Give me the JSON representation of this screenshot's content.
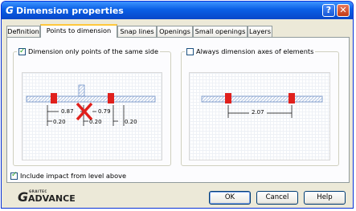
{
  "window": {
    "title": "Dimension properties",
    "help_label": "?",
    "close_label": "✕",
    "logo_glyph": "G"
  },
  "tabs": [
    {
      "label": "Definition",
      "active": false
    },
    {
      "label": "Points to dimension",
      "active": true
    },
    {
      "label": "Snap lines",
      "active": false
    },
    {
      "label": "Openings",
      "active": false
    },
    {
      "label": "Small openings",
      "active": false
    },
    {
      "label": "Layers",
      "active": false
    }
  ],
  "left_group": {
    "checkbox_label": "Dimension only points of the same side",
    "checked": true,
    "dims": {
      "d1": "0.87",
      "d2": "0.79",
      "s1": "0.20",
      "s2": "0.20",
      "s3": "0.20"
    }
  },
  "right_group": {
    "checkbox_label": "Always dimension axes of elements",
    "checked": false,
    "dims": {
      "d1": "2.07"
    }
  },
  "impact": {
    "label": "Include impact from level above",
    "checked": true
  },
  "logo": {
    "mark": "G",
    "small": "GRAITEC",
    "text": "ADVANCE"
  },
  "buttons": {
    "ok": "OK",
    "cancel": "Cancel",
    "help": "Help"
  }
}
